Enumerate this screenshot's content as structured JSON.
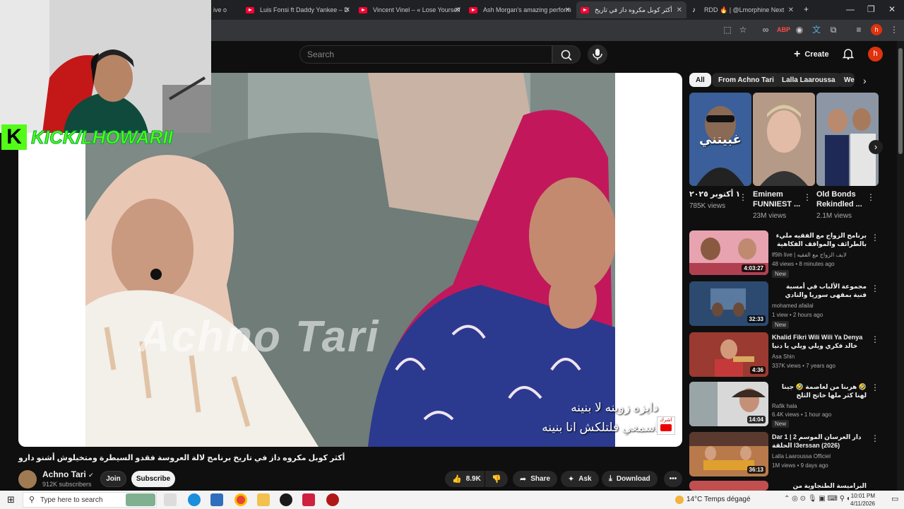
{
  "browser": {
    "tabs": [
      {
        "title": "ive o"
      },
      {
        "title": "Luis Fonsi ft Daddy Yankee – D"
      },
      {
        "title": "Vincent Vinel – « Lose Yourself"
      },
      {
        "title": "Ash Morgan's amazing perform"
      },
      {
        "title": "أكثر كوبل مكروه داز في تاريخ"
      },
      {
        "title": "RDD 🔥 | @Lmorphine Next"
      }
    ],
    "new_tab": "+",
    "minimize": "—",
    "maximize": "❐",
    "close": "✕"
  },
  "youtube": {
    "search_placeholder": "Search",
    "create_label": "Create",
    "avatar_letter": "h"
  },
  "player": {
    "watermark": "Achno Tari",
    "subtitle_line1": "دايزه زوينه لا بنينه",
    "subtitle_line2": "اسمعي فلتلكش انا بنينه",
    "overlay_text": "KICK/LHOWARII",
    "overlay_k": "K",
    "corner_logo": "اشرك"
  },
  "video": {
    "title": "أكثر كوبل مكروه داز في تاريخ برنامج لالة العروسة فقدو السيطرة ومتخيلوش أشنو دارو",
    "channel": "Achno Tari",
    "subscribers": "912K subscribers",
    "join": "Join",
    "subscribe": "Subscribe",
    "likes": "8.9K",
    "share": "Share",
    "ask": "Ask",
    "download": "Download"
  },
  "chips": [
    "All",
    "From Achno Tari",
    "Lalla Laaroussa",
    "We"
  ],
  "shorts": [
    {
      "overlay": "غبيتني",
      "title": "١ أكتوبر ٢٠٢٥",
      "views": "785K views"
    },
    {
      "overlay": "",
      "title": "Eminem FUNNIEST ...",
      "views": "23M views"
    },
    {
      "overlay": "",
      "title": "Old Bonds Rekindled ...",
      "views": "2.1M views"
    }
  ],
  "recommendations": [
    {
      "title": "برنامج الزواج مع الفقيه مليء بالطرائف والمواقف الفكاهية",
      "channel": "lf9ih live | لايف الزواج مع الفقيه",
      "meta": "48 views • 8 minutes ago",
      "duration": "4:03:27",
      "badge": "New"
    },
    {
      "title": "مجموعة الألباب في أمسية فنية بمقهى سوريا والنادي الثقافي تطوان",
      "channel": "mohamed afailal",
      "meta": "1 view • 2 hours ago",
      "duration": "32:33",
      "badge": "New"
    },
    {
      "title": "Khalid Fikri Wili Wili Ya Denya خالد فكري ويلي ويلي يا دنيا",
      "channel": "Asa Shin",
      "meta": "337K views • 7 years ago",
      "duration": "4:36",
      "badge": ""
    },
    {
      "title": "🤣 هربنا من لعاصمة 🤣 جينا لهنا كثر ملها خاتج الثلج فمراكش ❄️ ☃️",
      "channel": "Rafik hala",
      "meta": "6.4K views • 1 hour ago",
      "duration": "14:04",
      "badge": "New"
    },
    {
      "title": "Dar 1 دار العرسان الموسم 2 | الحلقة l3erssan (2026)",
      "channel": "Lalla Laaroussa Officiel",
      "meta": "1M views • 9 days ago",
      "duration": "36:13",
      "badge": ""
    },
    {
      "title": "البراميسة الطنجاوية من النوجة فالليل لوك",
      "channel": "",
      "meta": "",
      "duration": "",
      "badge": ""
    }
  ],
  "taskbar": {
    "search_placeholder": "Type here to search",
    "weather": "14°C  Temps dégagé",
    "time": "10:01 PM",
    "date": "4/11/2026"
  }
}
